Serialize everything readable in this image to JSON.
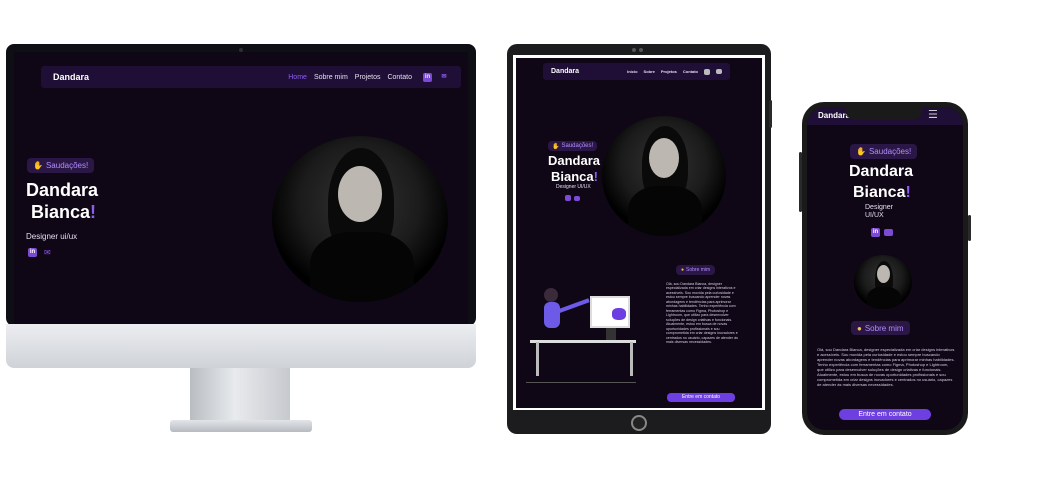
{
  "imac": {
    "nav": {
      "brand": "Dandara",
      "links": [
        "Home",
        "Sobre mim",
        "Projetos",
        "Contato"
      ],
      "icons": [
        "in",
        "✉"
      ]
    },
    "greeting": "Saudações!",
    "name_line1": "Dandara",
    "name_line2": "Bianca",
    "exclaim": "!",
    "role": "Designer ui/ux",
    "icons": [
      "in",
      "✉"
    ]
  },
  "tablet": {
    "nav": {
      "brand": "Dandara",
      "links": [
        "Início",
        "Sobre",
        "Projetos",
        "Contato"
      ]
    },
    "greeting": "Saudações!",
    "name_line1": "Dandara",
    "name_line2": "Bianca",
    "exclaim": "!",
    "role": "Designer UI/UX",
    "about_title": "Sobre mim",
    "about_text": "Olá, sou Dandara Bianca, designer especializada em criar designs interativos e acessíveis. Sou movida pela curiosidade e estou sempre buscando aprender novas abordagens e tendências para aprimorar minhas habilidades. Tenho experiência com ferramentas como Figma, Photoshop e Lightroom, que utilizo para desenvolver soluções de design criativas e funcionais. Atualmente, estou em busca de novas oportunidades profissionais e sou comprometida em criar designs inovadores e centrados no usuário, capazes de atender às mais diversas necessidades.",
    "cta": "Entre em contato"
  },
  "phone": {
    "brand": "Dandara",
    "menu_icon": "☰",
    "greeting": "Saudações!",
    "name_line1": "Dandara",
    "name_line2": "Bianca",
    "exclaim": "!",
    "role_line1": "Designer",
    "role_line2": "UI/UX",
    "about_title": "Sobre mim",
    "about_text": "Olá, sou Dandara Bianca, designer especializada em criar designs interativos e acessíveis. Sou movida pela curiosidade e estou sempre buscando aprender novas abordagens e tendências para aprimorar minhas habilidades. Tenho experiência com ferramentas como Figma, Photoshop e Lightroom, que utilizo para desenvolver soluções de design criativas e funcionais. Atualmente, estou em busca de novas oportunidades profissionais e sou comprometida em criar designs inovadores e centrados no usuário, capazes de atender às mais diversas necessidades.",
    "cta": "Entre em contato"
  },
  "colors": {
    "background": "#0f0616",
    "nav": "#1f0f36",
    "accent": "#8e5cf0",
    "button": "#6d3ee0"
  },
  "icon_names": [
    "linkedin-icon",
    "mail-icon",
    "apple-logo-icon",
    "hamburger-menu-icon",
    "waving-hand-icon"
  ]
}
